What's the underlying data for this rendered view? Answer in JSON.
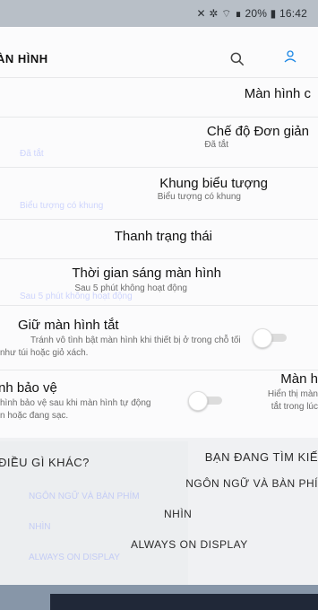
{
  "status_bar": {
    "left_text": "",
    "right_text": "✕ ✲ ⌔ ∎ 20% ▮ 16:42"
  },
  "header": {
    "title": "ÀN HÌNH"
  },
  "rows": [
    {
      "title": "Màn hình c",
      "sub": ""
    },
    {
      "title": "Chế độ Đơn giản",
      "sub": "Đã tắt",
      "ghost": "Đã tắt"
    },
    {
      "title": "Khung biểu tượng",
      "sub": "Biểu tượng có khung",
      "ghost": "Biểu tượng có khung"
    },
    {
      "title": "Thanh trạng thái",
      "sub": ""
    },
    {
      "title": "Thời gian sáng màn hình",
      "sub": "Sau 5 phút không hoạt động",
      "ghost": "Sau 5 phút không hoạt động"
    },
    {
      "title": "Giữ màn hình tắt",
      "sub_line1": "Tránh vô tình bật màn hình khi thiết bị ở trong chỗ tối",
      "sub_line2": "như túi hoặc giỏ xách."
    },
    {
      "title": "nh bảo vệ",
      "sub_line1": "hình bảo vệ sau khi màn hình tự động",
      "sub_line2": "n hoặc đang sạc."
    },
    {
      "title": "Màn h",
      "sub_line1": "Hiển thị màn",
      "sub_line2": "tắt trong lúc"
    }
  ],
  "bottom": {
    "left_title": "ĐIỀU GÌ KHÁC?",
    "right_title": "BẠN ĐANG TÌM KIẾ",
    "links": [
      "NGÔN NGỮ VÀ BÀN PHÍ",
      "NHÌN",
      "ALWAYS ON DISPLAY"
    ],
    "ghost_links": [
      "NGÔN NGỮ VÀ BÀN PHÍM",
      "NHÌN",
      "ALWAYS ON DISPLAY"
    ]
  }
}
